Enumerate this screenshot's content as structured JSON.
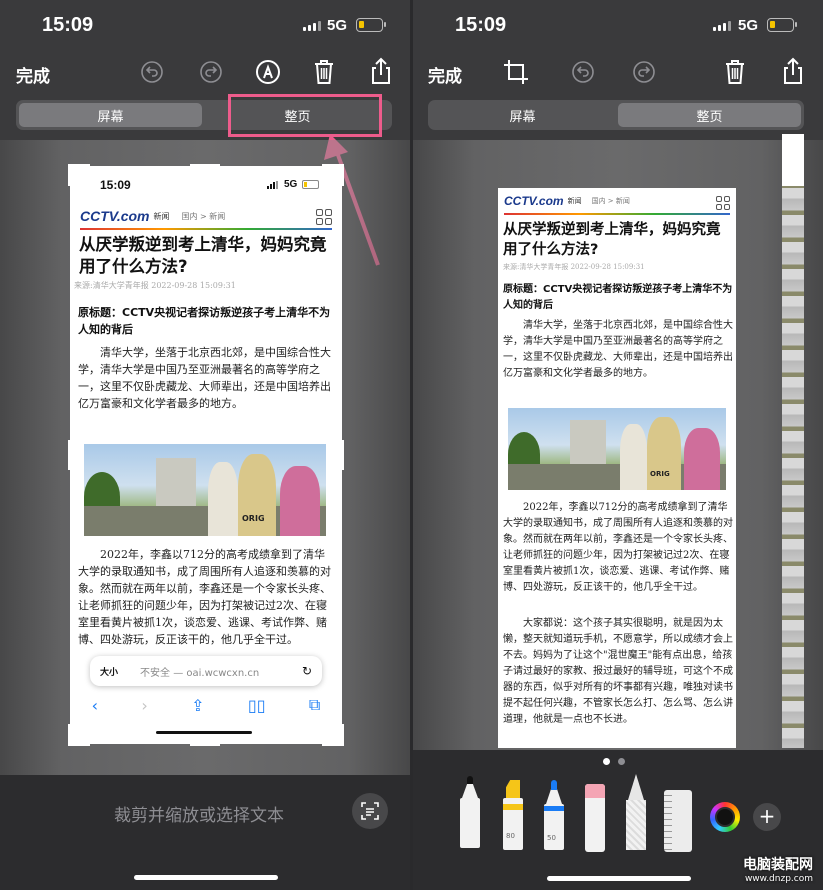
{
  "status": {
    "time": "15:09",
    "network": "5G"
  },
  "left": {
    "done_label": "完成",
    "tabs": [
      "屏幕",
      "整页"
    ],
    "bottom_prompt": "裁剪并缩放或选择文本"
  },
  "right": {
    "done_label": "完成",
    "tabs": [
      "屏幕",
      "整页"
    ],
    "page_dots": 2,
    "pen_labels": [
      "80",
      "50"
    ]
  },
  "article": {
    "time": "15:09",
    "network": "5G",
    "logo": "CCTV.com",
    "logo_small": "央视网",
    "logo_news": "新闻",
    "crumb": "国内 > 新闻",
    "title": "从厌学叛逆到考上清华，妈妈究竟用了什么方法?",
    "source": "来源:清华大学青年报  2022-09-28 15:09:31",
    "subtitle": "原标题：CCTV央视记者探访叛逆孩子考上清华不为人知的背后",
    "para1": "清华大学，坐落于北京西北郊，是中国综合性大学，清华大学是中国乃至亚洲最著名的高等学府之一，这里不仅卧虎藏龙、大师辈出，还是中国培养出亿万富豪和文化学者最多的地方。",
    "para2": "2022年，李鑫以712分的高考成绩拿到了清华大学的录取通知书，成了周围所有人追逐和羡慕的对象。然而就在两年以前，李鑫还是一个令家长头疼、让老师抓狂的问题少年，因为打架被记过2次、在寝室里看黄片被抓1次，谈恋爱、逃课、考试作弊、赌博、四处游玩，反正该干的，他几乎全干过。",
    "para3": "大家都说：这个孩子其实很聪明，就是因为太懒，整天就知道玩手机，不愿意学，所以成绩才会上不去。妈妈为了让这个\"混世魔王\"能有点出息，给孩子请过最好的家教、报过最好的辅导班，可这个不成器的东西，似乎对所有的坏事都有兴趣，唯独对读书提不起任何兴趣，不管家长怎么打、怎么骂、怎么讲道理，他就是一点也不长进。",
    "photo_badge": "ORIG",
    "address_size": "大小",
    "address_text": "不安全 — oai.wcwcxn.cn"
  },
  "watermark": {
    "name": "电脑装配网",
    "url": "www.dnzp.com"
  },
  "colors": {
    "highlight": "#ee5c8c",
    "battery": "#f5c400"
  }
}
